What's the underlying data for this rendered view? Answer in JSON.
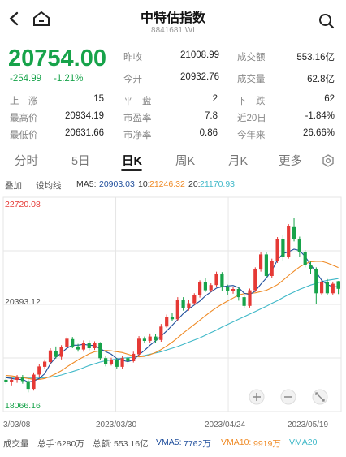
{
  "header": {
    "title": "中特估指数",
    "code": "8841681.WI"
  },
  "quote": {
    "price": "20754.00",
    "change": "-254.99",
    "change_pct": "-1.21%",
    "stats": [
      {
        "label": "昨收",
        "value": "21008.99",
        "label2": "成交额",
        "value2": "553.16亿"
      },
      {
        "label": "今开",
        "value": "20932.76",
        "label2": "成交量",
        "value2": "62.8亿"
      }
    ],
    "grid": [
      [
        {
          "label": "上　涨",
          "value": "15"
        },
        {
          "label": "平　盘",
          "value": "2"
        },
        {
          "label": "下　跌",
          "value": "62"
        }
      ],
      [
        {
          "label": "最高价",
          "value": "20934.19"
        },
        {
          "label": "市盈率",
          "value": "7.8"
        },
        {
          "label": "近20日",
          "value": "-1.84%"
        }
      ],
      [
        {
          "label": "最低价",
          "value": "20631.66"
        },
        {
          "label": "市净率",
          "value": "0.86"
        },
        {
          "label": "今年来",
          "value": "26.66%"
        }
      ]
    ]
  },
  "tabs": [
    "分时",
    "5日",
    "日K",
    "周K",
    "月K",
    "更多"
  ],
  "ma": {
    "opt1": "叠加",
    "opt2": "设均线",
    "ma5_label": "MA5:",
    "ma5": "20903.03",
    "ma10_label": "10:",
    "ma10": "21246.32",
    "ma20_label": "20:",
    "ma20": "21170.93"
  },
  "colors": {
    "up": "#e53935",
    "down": "#17a34a",
    "ma5": "#1f4e9c",
    "ma10": "#ef8a25",
    "ma20": "#3fb8c8",
    "grid": "#e6e6e6"
  },
  "chart_data": {
    "type": "candlestick",
    "y_top_label": "22720.08",
    "y_mid_label": "20393.12",
    "y_bottom_label": "18066.16",
    "ylim": [
      18066.16,
      22720.08
    ],
    "x_labels": [
      "3/03/08",
      "2023/03/30",
      "2023/04/24",
      "2023/05/19"
    ],
    "candles": [
      [
        18650,
        18600,
        18750,
        18550
      ],
      [
        18600,
        18650,
        18720,
        18520
      ],
      [
        18650,
        18700,
        18760,
        18580
      ],
      [
        18700,
        18620,
        18760,
        18560
      ],
      [
        18620,
        18440,
        18660,
        18360
      ],
      [
        18440,
        18770,
        18820,
        18400
      ],
      [
        18770,
        18960,
        19020,
        18700
      ],
      [
        18950,
        19070,
        19120,
        18900
      ],
      [
        19060,
        19330,
        19380,
        19020
      ],
      [
        19320,
        19180,
        19420,
        19140
      ],
      [
        19180,
        19400,
        19450,
        19120
      ],
      [
        19400,
        19600,
        19650,
        19350
      ],
      [
        19590,
        19420,
        19640,
        19380
      ],
      [
        19420,
        19350,
        19480,
        19300
      ],
      [
        19350,
        19500,
        19560,
        19300
      ],
      [
        19500,
        19380,
        19560,
        19330
      ],
      [
        19380,
        19500,
        19540,
        19340
      ],
      [
        19500,
        19150,
        19520,
        19100
      ],
      [
        19150,
        19020,
        19200,
        18960
      ],
      [
        19020,
        19100,
        19160,
        18980
      ],
      [
        19100,
        18950,
        19150,
        18900
      ],
      [
        18950,
        19150,
        19200,
        18900
      ],
      [
        19150,
        19080,
        19200,
        19000
      ],
      [
        19080,
        19250,
        19300,
        19050
      ],
      [
        19240,
        19600,
        19660,
        19200
      ],
      [
        19600,
        19550,
        19650,
        19500
      ],
      [
        19550,
        19650,
        19720,
        19500
      ],
      [
        19650,
        19560,
        19700,
        19500
      ],
      [
        19570,
        19880,
        19940,
        19530
      ],
      [
        19880,
        20100,
        20160,
        19850
      ],
      [
        20100,
        20050,
        20200,
        20000
      ],
      [
        20050,
        20500,
        20560,
        20020
      ],
      [
        20500,
        20300,
        20560,
        20250
      ],
      [
        20300,
        20420,
        20500,
        20250
      ],
      [
        20420,
        20600,
        20650,
        20380
      ],
      [
        20600,
        20900,
        20950,
        20550
      ],
      [
        20900,
        20720,
        21000,
        20680
      ],
      [
        20720,
        20840,
        20880,
        20680
      ],
      [
        20840,
        21100,
        21150,
        20800
      ],
      [
        21100,
        20800,
        21140,
        20700
      ],
      [
        20800,
        20700,
        20850,
        20600
      ],
      [
        20700,
        20750,
        20800,
        20640
      ],
      [
        20750,
        20560,
        20800,
        20480
      ],
      [
        20560,
        20360,
        20600,
        20300
      ],
      [
        20360,
        20720,
        20760,
        20320
      ],
      [
        20720,
        21200,
        21250,
        20680
      ],
      [
        21200,
        21550,
        21600,
        21150
      ],
      [
        21550,
        21050,
        21600,
        21000
      ],
      [
        21050,
        21400,
        21450,
        21000
      ],
      [
        21400,
        21900,
        21950,
        21350
      ],
      [
        21900,
        21500,
        22000,
        21400
      ],
      [
        21500,
        22200,
        22250,
        21450
      ],
      [
        22180,
        21900,
        22400,
        21850
      ],
      [
        21900,
        21600,
        21960,
        21500
      ],
      [
        21600,
        21300,
        21650,
        21250
      ],
      [
        21300,
        21200,
        21380,
        21100
      ],
      [
        21200,
        20650,
        21250,
        20400
      ],
      [
        20650,
        20900,
        20950,
        20600
      ],
      [
        20900,
        20650,
        20980,
        20600
      ],
      [
        20650,
        20870,
        20920,
        20620
      ],
      [
        20930,
        20754,
        20934,
        20632
      ]
    ],
    "ma5": [
      18700,
      18680,
      18660,
      18660,
      18600,
      18620,
      18680,
      18790,
      19020,
      19170,
      19270,
      19380,
      19450,
      19450,
      19470,
      19450,
      19440,
      19370,
      19300,
      19240,
      19140,
      19100,
      19070,
      19110,
      19230,
      19330,
      19450,
      19550,
      19660,
      19780,
      19910,
      20040,
      20180,
      20290,
      20380,
      20470,
      20590,
      20680,
      20770,
      20800,
      20820,
      20830,
      20780,
      20650,
      20620,
      20700,
      20860,
      21000,
      21180,
      21420,
      21570,
      21610,
      21670,
      21640,
      21500,
      21310,
      21140,
      20950,
      20850,
      20800,
      20800
    ],
    "ma10": [
      18750,
      18740,
      18720,
      18700,
      18680,
      18660,
      18660,
      18680,
      18730,
      18790,
      18860,
      18950,
      19030,
      19110,
      19180,
      19250,
      19300,
      19320,
      19330,
      19320,
      19300,
      19280,
      19240,
      19200,
      19180,
      19190,
      19230,
      19280,
      19350,
      19430,
      19520,
      19620,
      19730,
      19830,
      19930,
      20030,
      20130,
      20230,
      20320,
      20400,
      20470,
      20540,
      20610,
      20640,
      20650,
      20660,
      20690,
      20720,
      20780,
      20850,
      20950,
      21060,
      21160,
      21260,
      21330,
      21380,
      21390,
      21390,
      21350,
      21300,
      21246
    ],
    "ma20": [
      18700,
      18700,
      18700,
      18700,
      18690,
      18690,
      18690,
      18700,
      18710,
      18730,
      18760,
      18800,
      18840,
      18880,
      18930,
      18980,
      19020,
      19060,
      19090,
      19110,
      19130,
      19150,
      19160,
      19170,
      19190,
      19210,
      19240,
      19270,
      19300,
      19340,
      19380,
      19420,
      19470,
      19520,
      19570,
      19620,
      19680,
      19740,
      19800,
      19870,
      19930,
      19990,
      20050,
      20110,
      20170,
      20230,
      20290,
      20350,
      20420,
      20480,
      20550,
      20620,
      20680,
      20740,
      20790,
      20840,
      20880,
      20920,
      20950,
      20970,
      20990
    ]
  },
  "bottom": {
    "vol_label": "成交量",
    "shou_label": "总手:",
    "shou": "6280万",
    "amt_label": "总额:",
    "amt": "553.16亿",
    "vma5_label": "VMA5:",
    "vma5": "7762万",
    "vma10_label": "VMA10:",
    "vma10": "9919万",
    "vma20_label": "VMA20"
  }
}
